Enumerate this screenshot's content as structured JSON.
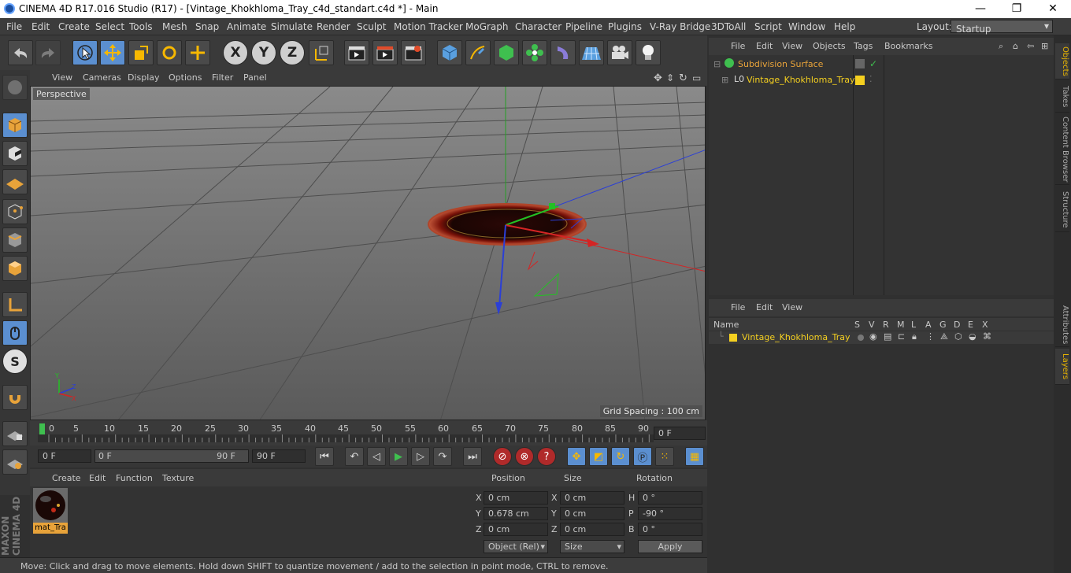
{
  "window": {
    "title": "CINEMA 4D R17.016 Studio (R17) - [Vintage_Khokhloma_Tray_c4d_standart.c4d *] - Main",
    "minimize": "—",
    "maximize": "❐",
    "close": "✕"
  },
  "menu": [
    "File",
    "Edit",
    "Create",
    "Select",
    "Tools",
    "Mesh",
    "Snap",
    "Animate",
    "Simulate",
    "Render",
    "Sculpt",
    "Motion Tracker",
    "MoGraph",
    "Character",
    "Pipeline",
    "Plugins",
    "V-Ray Bridge",
    "3DToAll",
    "Script",
    "Window",
    "Help"
  ],
  "layout": {
    "label": "Layout:",
    "value": "Startup"
  },
  "viewport": {
    "menu": [
      "View",
      "Cameras",
      "Display",
      "Options",
      "Filter",
      "Panel"
    ],
    "camera_label": "Perspective",
    "grid_spacing": "Grid Spacing : 100 cm"
  },
  "timeline": {
    "ticks": [
      "0",
      "5",
      "10",
      "15",
      "20",
      "25",
      "30",
      "35",
      "40",
      "45",
      "50",
      "55",
      "60",
      "65",
      "70",
      "75",
      "80",
      "85",
      "90"
    ],
    "current_frame": "0 F"
  },
  "transport": {
    "start": "0 F",
    "range_start": "0 F",
    "range_end": "90 F",
    "end": "90 F"
  },
  "material_panel": {
    "menu": [
      "Create",
      "Edit",
      "Function",
      "Texture"
    ],
    "material_name": "mat_Tra"
  },
  "coordinates": {
    "headers": {
      "position": "Position",
      "size": "Size",
      "rotation": "Rotation"
    },
    "rows": [
      {
        "axis": "X",
        "pos": "0 cm",
        "size_axis": "X",
        "size": "0 cm",
        "rot_axis": "H",
        "rot": "0 °"
      },
      {
        "axis": "Y",
        "pos": "0.678 cm",
        "size_axis": "Y",
        "size": "0 cm",
        "rot_axis": "P",
        "rot": "-90 °"
      },
      {
        "axis": "Z",
        "pos": "0 cm",
        "size_axis": "Z",
        "size": "0 cm",
        "rot_axis": "B",
        "rot": "0 °"
      }
    ],
    "mode": "Object (Rel)",
    "size_mode": "Size",
    "apply": "Apply"
  },
  "status": "Move: Click and drag to move elements. Hold down SHIFT to quantize movement / add to the selection in point mode, CTRL to remove.",
  "objects_panel": {
    "menu": [
      "File",
      "Edit",
      "View",
      "Objects",
      "Tags",
      "Bookmarks"
    ],
    "items": [
      {
        "name": "Subdivision Surface"
      },
      {
        "name": "Vintage_Khokhloma_Tray"
      }
    ]
  },
  "layers_panel": {
    "menu": [
      "File",
      "Edit",
      "View"
    ],
    "name_header": "Name",
    "columns": [
      "S",
      "V",
      "R",
      "M",
      "L",
      "A",
      "G",
      "D",
      "E",
      "X"
    ],
    "item": "Vintage_Khokhloma_Tray"
  },
  "side_tabs": {
    "top": [
      "Objects",
      "Takes",
      "Content Browser",
      "Structure"
    ],
    "bottom": [
      "Attributes",
      "Layers"
    ]
  },
  "brand": "MAXON CINEMA 4D"
}
